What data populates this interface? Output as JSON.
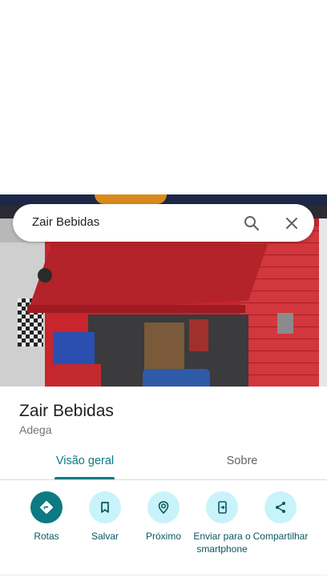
{
  "search": {
    "query": "Zair Bebidas"
  },
  "place": {
    "name": "Zair Bebidas",
    "category": "Adega"
  },
  "tabs": [
    {
      "label": "Visão geral",
      "selected": true
    },
    {
      "label": "Sobre",
      "selected": false
    }
  ],
  "actions": [
    {
      "label": "Rotas",
      "icon": "directions-icon"
    },
    {
      "label": "Salvar",
      "icon": "bookmark-icon"
    },
    {
      "label": "Próximo",
      "icon": "nearby-icon"
    },
    {
      "label": "Enviar para o smartphone",
      "icon": "send-to-phone-icon"
    },
    {
      "label": "Compartilhar",
      "icon": "share-icon"
    }
  ],
  "colors": {
    "accent": "#0b7a83",
    "action_bg": "#c8f3fa"
  }
}
